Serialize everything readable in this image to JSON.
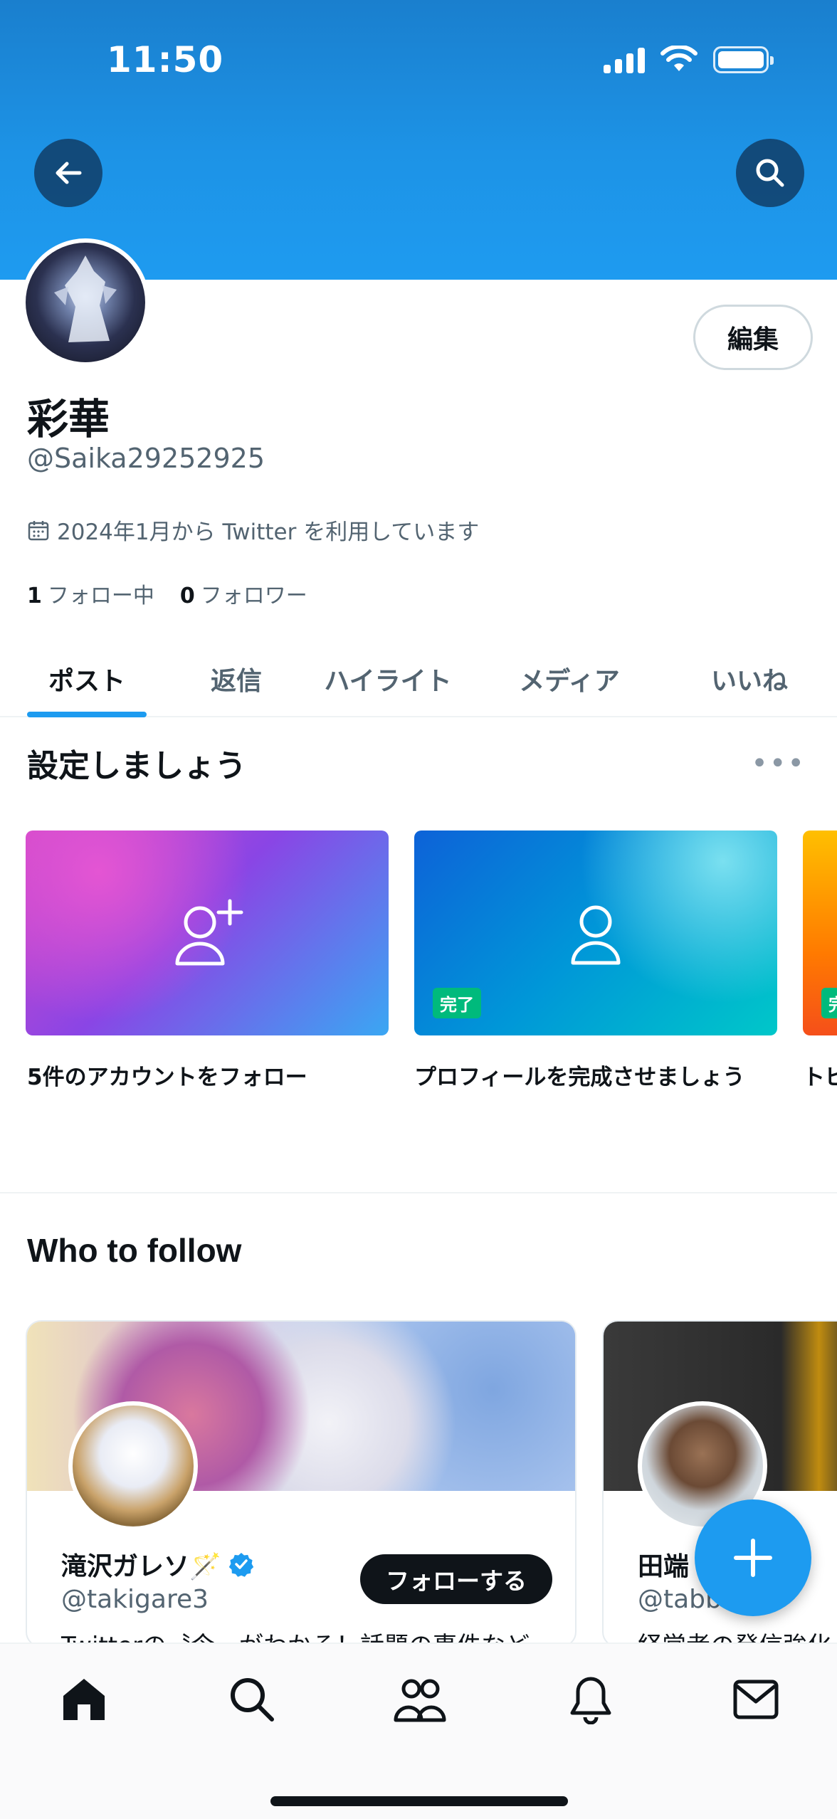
{
  "status_bar": {
    "time": "11:50"
  },
  "profile": {
    "display_name": "彩華",
    "handle": "@Saika29252925",
    "joined": "2024年1月から Twitter を利用しています",
    "edit_label": "編集",
    "following_count": "1",
    "following_label": "フォロー中",
    "followers_count": "0",
    "followers_label": "フォロワー"
  },
  "tabs": [
    {
      "label": "ポスト",
      "active": true
    },
    {
      "label": "返信"
    },
    {
      "label": "ハイライト"
    },
    {
      "label": "メディア"
    },
    {
      "label": "いいね"
    }
  ],
  "setup": {
    "title": "設定しましょう",
    "cards": [
      {
        "label": "5件のアカウントをフォロー",
        "icon": "add-user-icon",
        "done": false
      },
      {
        "label": "プロフィールを完成させましょう",
        "icon": "user-icon",
        "done": true,
        "done_label": "完了"
      },
      {
        "label": "トピ",
        "done": true,
        "done_label": "完"
      }
    ]
  },
  "who_to_follow": {
    "title": "Who to follow",
    "accounts": [
      {
        "name": "滝沢ガレソ🪄",
        "handle": "@takigare3",
        "bio": "Twitterの〝今〟がわかる！話題の事件など",
        "verified": true,
        "follow_label": "フォローする"
      },
      {
        "name": "田端 BA",
        "handle": "@tabb",
        "bio": "経営者の発信強化"
      }
    ]
  },
  "bottom_nav": [
    "home-icon",
    "search-icon",
    "communities-icon",
    "notifications-icon",
    "messages-icon"
  ],
  "colors": {
    "accent": "#1d9bf0",
    "banner": "#1e90e3",
    "done": "#00ba7c",
    "text": "#0f1419",
    "muted": "#536471"
  }
}
